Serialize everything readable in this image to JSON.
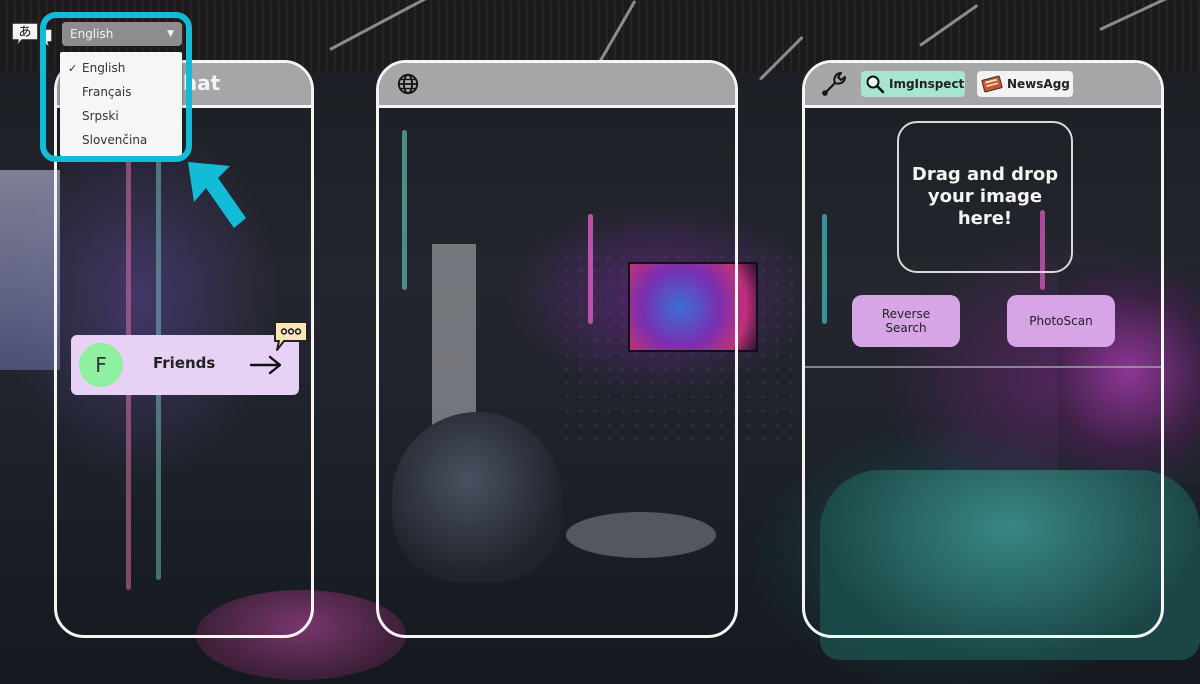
{
  "language": {
    "selected": "English",
    "options": [
      "English",
      "Français",
      "Srpski",
      "Slovenčina"
    ],
    "icon": "language-icon",
    "icon_glyph": "あ"
  },
  "chat_panel": {
    "title": "chat",
    "friends": {
      "avatar_initial": "F",
      "label": "Friends",
      "arrow_icon": "arrow-right-icon",
      "bubble_icon": "speech-bubble-icon"
    }
  },
  "web_panel": {
    "icon": "globe-icon"
  },
  "tools_panel": {
    "tools_icon": "wrench-icon",
    "tabs": [
      {
        "label": "ImgInspect",
        "icon": "magnifier-icon"
      },
      {
        "label": "NewsAgg",
        "icon": "newspaper-icon"
      }
    ],
    "dropzone_text": "Drag and drop your image here!",
    "buttons": {
      "reverse_search": "Reverse Search",
      "photoscan": "PhotoScan"
    }
  },
  "colors": {
    "highlight": "#13bcd6",
    "panel_header": "#a6a6a8",
    "friends_card": "#e7d2f5",
    "avatar": "#8ef0a0",
    "action_button": "#d7a4e6",
    "imginspect_tab": "#a8e5cf"
  }
}
